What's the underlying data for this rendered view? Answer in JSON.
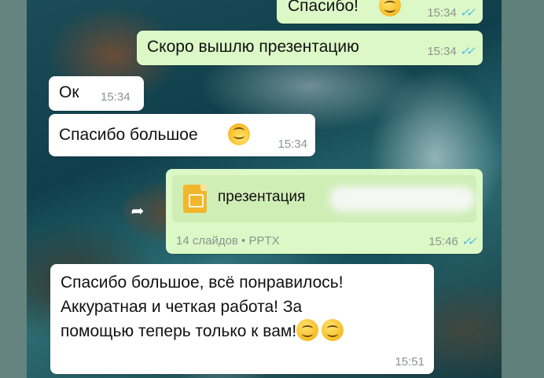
{
  "messages": [
    {
      "id": "m1",
      "direction": "out",
      "text": "Спасибо!",
      "emoji": "smile",
      "time": "15:34",
      "status": "read"
    },
    {
      "id": "m2",
      "direction": "out",
      "text": "Скоро вышлю презентацию",
      "time": "15:34",
      "status": "read"
    },
    {
      "id": "m3",
      "direction": "in",
      "text": "Ок",
      "time": "15:34"
    },
    {
      "id": "m4",
      "direction": "in",
      "text": "Спасибо большое",
      "emoji": "upside-down-smile",
      "time": "15:34"
    },
    {
      "id": "m5",
      "direction": "out",
      "type": "document",
      "file_name": "презентация",
      "file_info": "14 слайдов • PPTX",
      "file_icon": "slides-file-icon",
      "time": "15:46",
      "status": "read"
    },
    {
      "id": "m6",
      "direction": "in",
      "lines": [
        "Спасибо большое,  всё понравилось!",
        "Аккуратная и четкая работа! За",
        "помощью теперь только к вам!"
      ],
      "emoji": [
        "slightly-smiling",
        "relieved"
      ],
      "time": "15:51"
    }
  ],
  "icons": {
    "read_ticks": "double-check-icon",
    "forward": "forward-arrow-icon"
  },
  "colors": {
    "outgoing_bubble": "#dcf8c6",
    "incoming_bubble": "#ffffff",
    "read_ticks": "#4fb6ec"
  }
}
